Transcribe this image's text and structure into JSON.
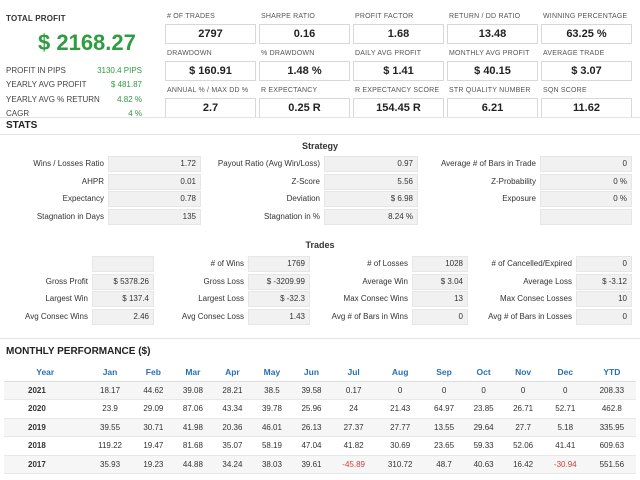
{
  "summary": {
    "total_profit_label": "TOTAL PROFIT",
    "total_profit_value": "$ 2168.27",
    "rows": [
      {
        "label": "PROFIT IN PIPS",
        "value": "3130.4 PIPS"
      },
      {
        "label": "YEARLY AVG PROFIT",
        "value": "$ 481.87"
      },
      {
        "label": "YEARLY AVG % RETURN",
        "value": "4.82 %"
      },
      {
        "label": "CAGR",
        "value": "4 %"
      }
    ],
    "kpis": [
      {
        "label": "# OF TRADES",
        "value": "2797"
      },
      {
        "label": "SHARPE RATIO",
        "value": "0.16"
      },
      {
        "label": "PROFIT FACTOR",
        "value": "1.68"
      },
      {
        "label": "RETURN / DD RATIO",
        "value": "13.48"
      },
      {
        "label": "WINNING PERCENTAGE",
        "value": "63.25 %"
      },
      {
        "label": "DRAWDOWN",
        "value": "$ 160.91"
      },
      {
        "label": "% DRAWDOWN",
        "value": "1.48 %"
      },
      {
        "label": "DAILY AVG PROFIT",
        "value": "$ 1.41"
      },
      {
        "label": "MONTHLY AVG PROFIT",
        "value": "$ 40.15"
      },
      {
        "label": "AVERAGE TRADE",
        "value": "$ 3.07"
      },
      {
        "label": "ANNUAL % / MAX DD %",
        "value": "2.7"
      },
      {
        "label": "R EXPECTANCY",
        "value": "0.25 R"
      },
      {
        "label": "R EXPECTANCY SCORE",
        "value": "154.45 R"
      },
      {
        "label": "STR QUALITY NUMBER",
        "value": "6.21"
      },
      {
        "label": "SQN SCORE",
        "value": "11.62"
      }
    ]
  },
  "stats": {
    "title": "STATS",
    "strategy": {
      "title": "Strategy",
      "rows": [
        [
          {
            "label": "Wins / Losses Ratio",
            "value": "1.72"
          },
          {
            "label": "Payout Ratio (Avg Win/Loss)",
            "value": "0.97"
          },
          {
            "label": "Average # of Bars in Trade",
            "value": "0"
          }
        ],
        [
          {
            "label": "AHPR",
            "value": "0.01"
          },
          {
            "label": "Z-Score",
            "value": "5.56"
          },
          {
            "label": "Z-Probability",
            "value": "0 %"
          }
        ],
        [
          {
            "label": "Expectancy",
            "value": "0.78"
          },
          {
            "label": "Deviation",
            "value": "$ 6.98"
          },
          {
            "label": "Exposure",
            "value": "0 %"
          }
        ],
        [
          {
            "label": "Stagnation in Days",
            "value": "135"
          },
          {
            "label": "Stagnation in %",
            "value": "8.24 %"
          },
          {
            "label": "",
            "value": ""
          }
        ]
      ]
    },
    "trades": {
      "title": "Trades",
      "rows": [
        [
          {
            "label": "",
            "value": ""
          },
          {
            "label": "# of Wins",
            "value": "1769"
          },
          {
            "label": "# of Losses",
            "value": "1028"
          },
          {
            "label": "# of Cancelled/Expired",
            "value": "0"
          }
        ],
        [
          {
            "label": "Gross Profit",
            "value": "$ 5378.26"
          },
          {
            "label": "Gross Loss",
            "value": "$ -3209.99"
          },
          {
            "label": "Average Win",
            "value": "$ 3.04"
          },
          {
            "label": "Average Loss",
            "value": "$ -3.12"
          }
        ],
        [
          {
            "label": "Largest Win",
            "value": "$ 137.4"
          },
          {
            "label": "Largest Loss",
            "value": "$ -32.3"
          },
          {
            "label": "Max Consec Wins",
            "value": "13"
          },
          {
            "label": "Max Consec Losses",
            "value": "10"
          }
        ],
        [
          {
            "label": "Avg Consec Wins",
            "value": "2.46"
          },
          {
            "label": "Avg Consec Loss",
            "value": "1.43"
          },
          {
            "label": "Avg # of Bars in Wins",
            "value": "0"
          },
          {
            "label": "Avg # of Bars in Losses",
            "value": "0"
          }
        ]
      ]
    }
  },
  "monthly": {
    "title": "MONTHLY PERFORMANCE ($)",
    "headers": [
      "Year",
      "Jan",
      "Feb",
      "Mar",
      "Apr",
      "May",
      "Jun",
      "Jul",
      "Aug",
      "Sep",
      "Oct",
      "Nov",
      "Dec",
      "YTD"
    ],
    "rows": [
      [
        "2021",
        "18.17",
        "44.62",
        "39.08",
        "28.21",
        "38.5",
        "39.58",
        "0.17",
        "0",
        "0",
        "0",
        "0",
        "0",
        "208.33"
      ],
      [
        "2020",
        "23.9",
        "29.09",
        "87.06",
        "43.34",
        "39.78",
        "25.96",
        "24",
        "21.43",
        "64.97",
        "23.85",
        "26.71",
        "52.71",
        "462.8"
      ],
      [
        "2019",
        "39.55",
        "30.71",
        "41.98",
        "20.36",
        "46.01",
        "26.13",
        "27.37",
        "27.77",
        "13.55",
        "29.64",
        "27.7",
        "5.18",
        "335.95"
      ],
      [
        "2018",
        "119.22",
        "19.47",
        "81.68",
        "35.07",
        "58.19",
        "47.04",
        "41.82",
        "30.69",
        "23.65",
        "59.33",
        "52.06",
        "41.41",
        "609.63"
      ],
      [
        "2017",
        "35.93",
        "19.23",
        "44.88",
        "34.24",
        "38.03",
        "39.61",
        "-45.89",
        "310.72",
        "48.7",
        "40.63",
        "16.42",
        "-30.94",
        "551.56"
      ]
    ]
  },
  "colors": {
    "profit_green": "#2e9c3f",
    "negative_red": "#d33b3b",
    "header_blue": "#2a6fb5"
  }
}
